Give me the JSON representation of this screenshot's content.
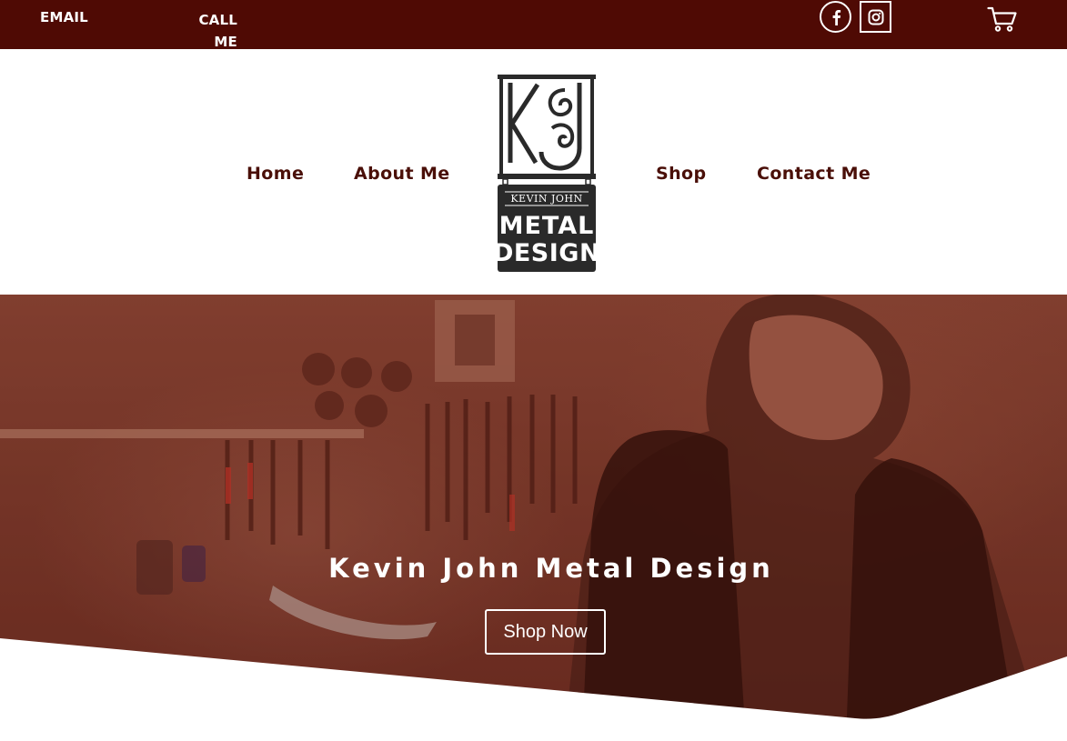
{
  "topbar": {
    "email_label": "EMAIL",
    "call_label_line1": "CALL",
    "call_label_line2": "ME",
    "social": [
      "facebook-icon",
      "instagram-icon"
    ],
    "cart_icon": "cart-icon",
    "background": "#4f0a04"
  },
  "nav": {
    "items": [
      {
        "label": "Home"
      },
      {
        "label": "About Me"
      },
      {
        "label": "Shop"
      },
      {
        "label": "Contact Me"
      }
    ],
    "color": "#4a0f08"
  },
  "logo": {
    "monogram": "KJ",
    "line1": "KEVIN JOHN",
    "line2": "METAL",
    "line3": "DESIGN"
  },
  "hero": {
    "title": "Kevin John Metal Design",
    "button_label": "Shop Now",
    "overlay_color": "#7a3a2c"
  }
}
